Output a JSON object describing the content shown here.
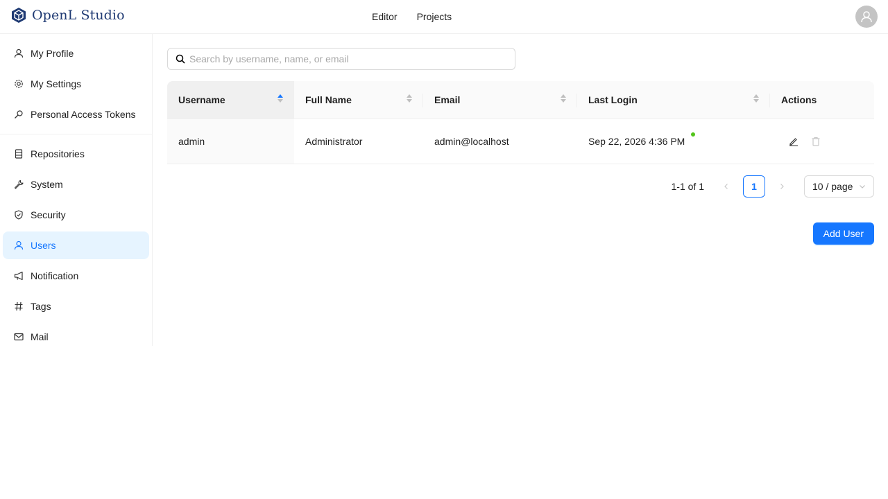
{
  "app": {
    "title": "OpenL Studio",
    "brand_color": "#1f3a73",
    "accent_color": "#1677ff"
  },
  "topnav": {
    "items": [
      {
        "label": "Editor"
      },
      {
        "label": "Projects"
      }
    ],
    "avatar_icon": "user-avatar-icon"
  },
  "sidebar": {
    "items": [
      {
        "label": "My Profile",
        "icon": "user-icon"
      },
      {
        "label": "My Settings",
        "icon": "gear-icon"
      },
      {
        "label": "Personal Access Tokens",
        "icon": "key-icon"
      },
      {
        "label": "Repositories",
        "icon": "database-icon"
      },
      {
        "label": "System",
        "icon": "wrench-icon"
      },
      {
        "label": "Security",
        "icon": "shield-icon"
      },
      {
        "label": "Users",
        "icon": "user-icon",
        "active": true
      },
      {
        "label": "Notification",
        "icon": "megaphone-icon"
      },
      {
        "label": "Tags",
        "icon": "hash-icon"
      },
      {
        "label": "Mail",
        "icon": "mail-icon"
      }
    ]
  },
  "search": {
    "placeholder": "Search by username, name, or email",
    "value": ""
  },
  "table": {
    "columns": [
      {
        "label": "Username",
        "sort": "ascending"
      },
      {
        "label": "Full Name",
        "sort": "none"
      },
      {
        "label": "Email",
        "sort": "none"
      },
      {
        "label": "Last Login",
        "sort": "none"
      },
      {
        "label": "Actions"
      }
    ],
    "rows": [
      {
        "username": "admin",
        "full_name": "Administrator",
        "email": "admin@localhost",
        "last_login": "Sep 22, 2026 4:36 PM",
        "online": true,
        "actions": [
          "edit-icon",
          "delete-icon"
        ]
      }
    ]
  },
  "pagination": {
    "total_text": "1-1 of 1",
    "current_page": "1",
    "page_size": "10 / page"
  },
  "actions": {
    "add_user_label": "Add User"
  },
  "colors": {
    "online": "#52c41a",
    "active_bg": "#e6f4ff"
  }
}
